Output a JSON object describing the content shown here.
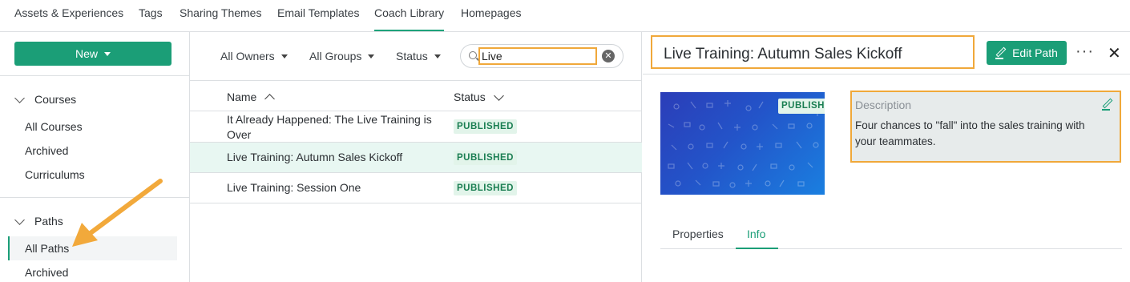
{
  "topnav": {
    "tabs": [
      {
        "label": "Assets & Experiences"
      },
      {
        "label": "Tags"
      },
      {
        "label": "Sharing Themes"
      },
      {
        "label": "Email Templates"
      },
      {
        "label": "Coach Library"
      },
      {
        "label": "Homepages"
      }
    ],
    "active": "Coach Library"
  },
  "sidebar": {
    "new_label": "New",
    "courses": {
      "label": "Courses",
      "items": [
        "All Courses",
        "Archived",
        "Curriculums"
      ]
    },
    "paths": {
      "label": "Paths",
      "items": [
        "All Paths",
        "Archived"
      ]
    },
    "active_item": "All Paths"
  },
  "filters": {
    "owners": "All Owners",
    "groups": "All Groups",
    "status": "Status",
    "search_value": "Live"
  },
  "list": {
    "columns": {
      "name": "Name",
      "status": "Status"
    },
    "rows": [
      {
        "name": "It Already Happened: The Live Training is Over",
        "status": "PUBLISHED"
      },
      {
        "name": "Live Training: Autumn Sales Kickoff",
        "status": "PUBLISHED"
      },
      {
        "name": "Live Training: Session One",
        "status": "PUBLISHED"
      }
    ]
  },
  "detail": {
    "title": "Live Training: Autumn Sales Kickoff",
    "edit_label": "Edit Path",
    "more_label": "···",
    "close_label": "✕",
    "thumb_badge": "PUBLISHED",
    "description_label": "Description",
    "description_text": "Four chances to \"fall\" into the sales training with your teammates.",
    "tabs": [
      "Properties",
      "Info"
    ],
    "active_tab": "Info"
  },
  "colors": {
    "accent": "#1b9e77",
    "highlight": "#f0a83a"
  }
}
